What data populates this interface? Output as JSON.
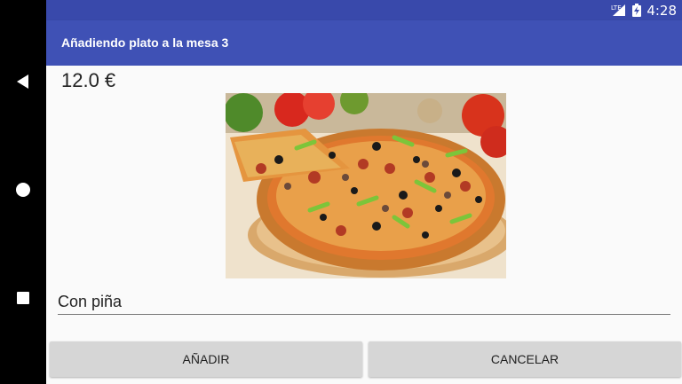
{
  "status_bar": {
    "network": "LTE",
    "time": "4:28"
  },
  "app_bar": {
    "title": "Añadiendo plato a la mesa 3"
  },
  "dish": {
    "price": "12.0 €",
    "image": "pizza-photo",
    "description": "Con piña"
  },
  "buttons": {
    "add": "AÑADIR",
    "cancel": "CANCELAR"
  },
  "colors": {
    "status_bar": "#3949ab",
    "app_bar": "#3f51b5",
    "button": "#d6d6d6"
  },
  "navigation": {
    "back": "back-icon",
    "home": "home-icon",
    "recents": "recents-icon"
  }
}
